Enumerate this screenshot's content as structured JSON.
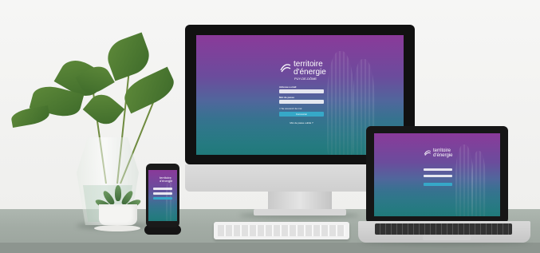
{
  "scene": {
    "colors": {
      "primary_gradient_top": "#8a3a9a",
      "primary_gradient_bottom": "#2aa3a4",
      "button": "#36a8c8"
    }
  },
  "login_screen": {
    "brand_line1": "territoire",
    "brand_line2": "d'énergie",
    "brand_line3": "PUY-DE-DÔME",
    "field1_label": "Adresse e-mail",
    "field1_placeholder": "",
    "field2_label": "Mot de passe",
    "field2_placeholder": "",
    "remember_label": "Se souvenir de moi",
    "submit_label": "Connexion",
    "forgot_link": "Mot de passe oublié ?"
  }
}
